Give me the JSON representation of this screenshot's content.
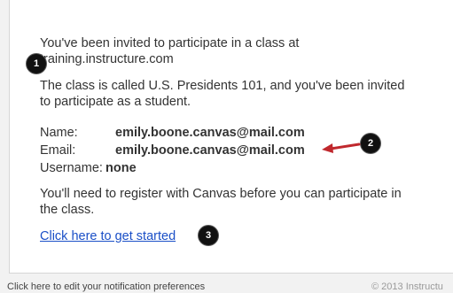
{
  "email": {
    "intro_line1": "You've been invited to participate in a class at",
    "intro_line2": "training.instructure.com",
    "class_line1": "The class is called U.S. Presidents 101, and you've been invited",
    "class_line2": "to participate as a student.",
    "details": {
      "name_label": "Name:",
      "name_value": "emily.boone.canvas@mail.com",
      "email_label": "Email:",
      "email_value": "emily.boone.canvas@mail.com",
      "username_label": "Username:",
      "username_value": "none"
    },
    "register_line1": "You'll need to register with Canvas before you can participate in",
    "register_line2": "the class.",
    "get_started_link": "Click here to get started"
  },
  "annotations": {
    "badge1": "1",
    "badge2": "2",
    "badge3": "3",
    "arrow_color": "#c0282d"
  },
  "footer": {
    "preferences_link": "Click here to edit your notification preferences",
    "copyright": "© 2013 Instructu"
  }
}
